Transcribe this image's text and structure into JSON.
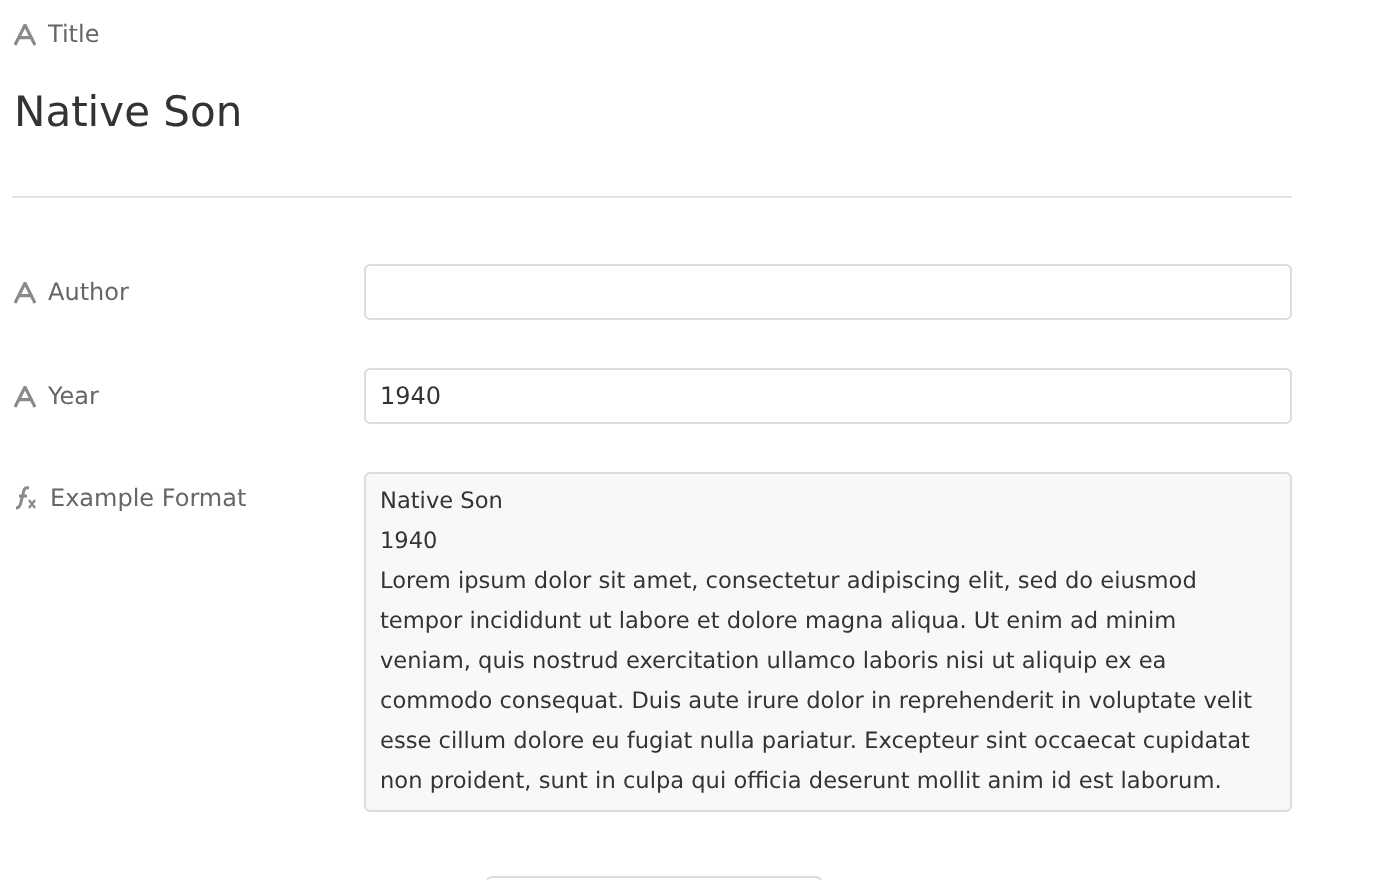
{
  "title_field": {
    "label": "Title",
    "value": "Native Son"
  },
  "fields": [
    {
      "kind": "text",
      "label": "Author"
    },
    {
      "kind": "text",
      "label": "Year",
      "value": "1940"
    },
    {
      "kind": "formula",
      "label": "Example Format",
      "lines": [
        "Native Son",
        "1940",
        "Lorem ipsum dolor sit amet, consectetur adipiscing elit, sed do eiusmod",
        "tempor incididunt ut labore et dolore magna aliqua. Ut enim ad minim",
        "veniam, quis nostrud exercitation ullamco laboris nisi ut aliquip ex ea",
        "commodo consequat. Duis aute irure dolor in reprehenderit in voluptate velit",
        "esse cillum dolore eu fugiat nulla pariatur. Excepteur sint occaecat cupidatat",
        "non proident, sunt in culpa qui officia deserunt mollit anim id est laborum."
      ]
    }
  ]
}
